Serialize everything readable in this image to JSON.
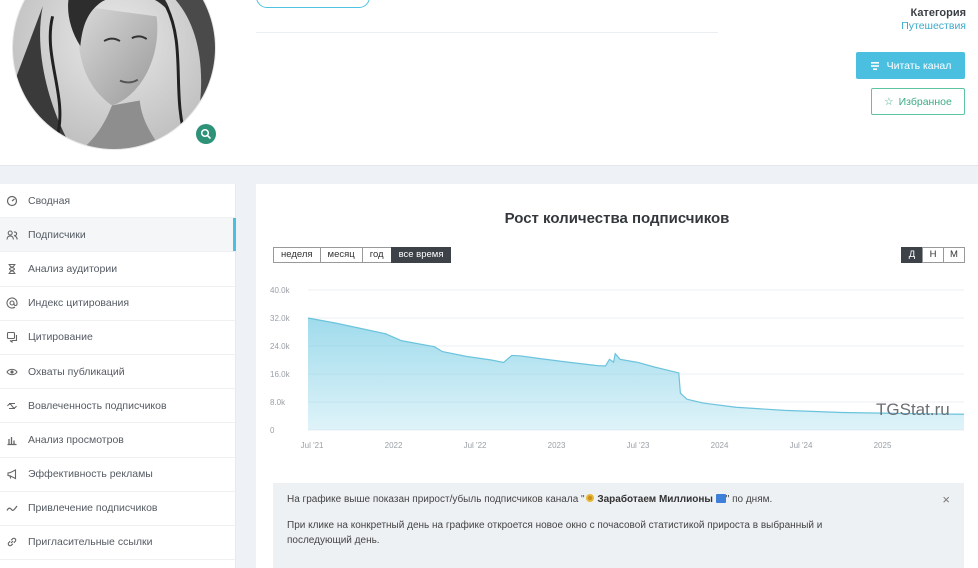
{
  "header": {
    "category_label": "Категория",
    "category_value": "Путешествия",
    "read_button": "Читать канал",
    "favorite_button": "Избранное"
  },
  "sidebar": {
    "items": [
      {
        "label": "Сводная",
        "icon": "gauge-icon"
      },
      {
        "label": "Подписчики",
        "icon": "users-icon",
        "active": true
      },
      {
        "label": "Анализ аудитории",
        "icon": "hourglass-icon"
      },
      {
        "label": "Индекс цитирования",
        "icon": "at-icon"
      },
      {
        "label": "Цитирование",
        "icon": "quote-icon"
      },
      {
        "label": "Охваты публикаций",
        "icon": "eye-icon"
      },
      {
        "label": "Вовлеченность подписчиков",
        "icon": "engagement-icon"
      },
      {
        "label": "Анализ просмотров",
        "icon": "bar-chart-icon"
      },
      {
        "label": "Эффективность рекламы",
        "icon": "megaphone-icon"
      },
      {
        "label": "Привлечение подписчиков",
        "icon": "trend-icon"
      },
      {
        "label": "Пригласительные ссылки",
        "icon": "link-icon"
      }
    ]
  },
  "main": {
    "title": "Рост количества подписчиков",
    "ranges": [
      "неделя",
      "месяц",
      "год",
      "все время"
    ],
    "active_range": "все время",
    "resolutions": [
      "Д",
      "Н",
      "М"
    ],
    "active_resolution": "Д",
    "watermark": "TGStat.ru",
    "notice": {
      "prefix": "На графике выше показан прирост/убыль подписчиков канала \"",
      "channel": "Заработаем Миллионы",
      "suffix": "\" по дням.",
      "line2": "При клике на конкретный день на графике откроется новое окно с почасовой статистикой прироста в выбранный и последующий день."
    }
  },
  "chart_data": {
    "type": "area",
    "title": "Рост количества подписчиков",
    "y_ticks": [
      "0",
      "8.0k",
      "16.0k",
      "24.0k",
      "32.0k",
      "40.0k"
    ],
    "ylim": [
      0,
      40000
    ],
    "x_ticks": [
      "Jul '21",
      "2022",
      "Jul '22",
      "2023",
      "Jul '23",
      "2024",
      "Jul '24",
      "2025"
    ],
    "x_tick_pos": [
      0.0,
      1.0,
      2.0,
      3.0,
      4.0,
      5.0,
      6.0,
      7.0
    ],
    "xlim": [
      -0.05,
      8.0
    ],
    "color": "#7fcfe6",
    "grid": true,
    "series": [
      {
        "points": [
          [
            -0.05,
            32000
          ],
          [
            0.3,
            30500
          ],
          [
            0.6,
            29000
          ],
          [
            0.9,
            27500
          ],
          [
            1.1,
            25500
          ],
          [
            1.5,
            23800
          ],
          [
            1.6,
            22400
          ],
          [
            1.9,
            21000
          ],
          [
            2.2,
            20000
          ],
          [
            2.35,
            19300
          ],
          [
            2.45,
            21300
          ],
          [
            2.55,
            21200
          ],
          [
            2.8,
            20400
          ],
          [
            3.1,
            19500
          ],
          [
            3.5,
            18400
          ],
          [
            3.6,
            18300
          ],
          [
            3.65,
            20200
          ],
          [
            3.7,
            19400
          ],
          [
            3.72,
            21800
          ],
          [
            3.78,
            20200
          ],
          [
            4.0,
            19300
          ],
          [
            4.2,
            18000
          ],
          [
            4.5,
            16300
          ],
          [
            4.52,
            10500
          ],
          [
            4.6,
            8800
          ],
          [
            4.8,
            7700
          ],
          [
            5.2,
            6500
          ],
          [
            5.8,
            5600
          ],
          [
            6.5,
            5000
          ],
          [
            7.3,
            4700
          ],
          [
            8.0,
            4500
          ]
        ]
      }
    ]
  }
}
